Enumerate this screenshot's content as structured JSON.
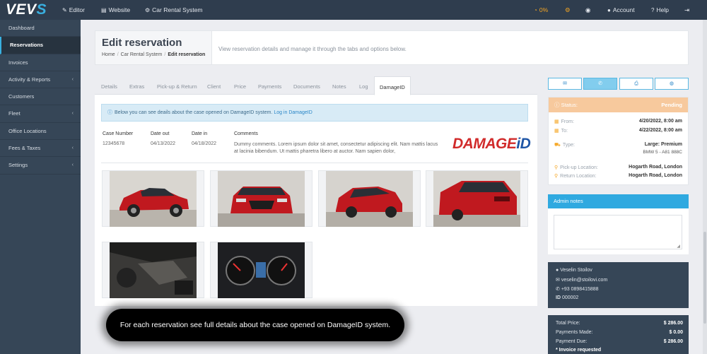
{
  "topbar": {
    "logo_main": "VEV",
    "logo_accent": "S",
    "editor": "Editor",
    "website": "Website",
    "car_rental": "Car Rental System",
    "percent": "0%",
    "account": "Account",
    "help": "Help"
  },
  "sidebar": {
    "items": [
      {
        "label": "Dashboard"
      },
      {
        "label": "Reservations"
      },
      {
        "label": "Invoices"
      },
      {
        "label": "Activity & Reports"
      },
      {
        "label": "Customers"
      },
      {
        "label": "Fleet"
      },
      {
        "label": "Office Locations"
      },
      {
        "label": "Fees & Taxes"
      },
      {
        "label": "Settings"
      }
    ]
  },
  "header": {
    "title": "Edit reservation",
    "breadcrumb": [
      "Home",
      "Car Rental System",
      "Edit reservation"
    ],
    "description": "View reservation details and manage it through the tabs and options below."
  },
  "tabs": [
    "Details",
    "Extras",
    "Pick-up & Return",
    "Client",
    "Price",
    "Payments",
    "Documents",
    "Notes",
    "Log",
    "DamageID"
  ],
  "damage": {
    "info_text": "Below you can see deails about the case opened on DamageID system.",
    "info_link": "Log in DamageID",
    "headers": {
      "case": "Case Number",
      "date_out": "Date out",
      "date_in": "Date in",
      "comments": "Comments"
    },
    "case_number": "12345678",
    "date_out": "04/13/2022",
    "date_in": "04/18/2022",
    "comments": "Dummy comments. Lorem ipsum dolor sit amet, consectetur adipiscing elit. Nam mattis lacus at lacinia bibendum. Ut mattis pharetra libero at auctor. Nam sapien dolor,",
    "logo_a": "DAMAGE",
    "logo_b": "iD"
  },
  "status": {
    "label": "Status:",
    "value": "Pending",
    "from_label": "From:",
    "from_value": "4/20/2022, 8:00 am",
    "to_label": "To:",
    "to_value": "4/22/2022, 8:00 am",
    "type_label": "Type:",
    "type_value": "Large: Premium",
    "type_sub": "BMW 5 - A81 888C",
    "pickup_label": "Pick-up Location:",
    "pickup_value": "Hogarth Road, London",
    "return_label": "Return Location:",
    "return_value": "Hogarth Road, London"
  },
  "admin": {
    "title": "Admin notes"
  },
  "client": {
    "name": "Veselin Stoilov",
    "email": "veselin@stoilovi.com",
    "phone": "+93 0898415888",
    "id_label": "ID",
    "id_value": "000002"
  },
  "price": {
    "total_label": "Total Price:",
    "total_value": "$ 286.00",
    "made_label": "Payments Made:",
    "made_value": "$ 0.00",
    "due_label": "Payment Due:",
    "due_value": "$ 286.00",
    "invoice": "* Invoice requested"
  },
  "caption": "For each reservation see full details about the case opened on DamageID system.",
  "colors": {
    "accent": "#39b0e0",
    "sidebar": "#364657",
    "status_pending": "#f7c99d",
    "damage_red": "#d12b2b"
  }
}
